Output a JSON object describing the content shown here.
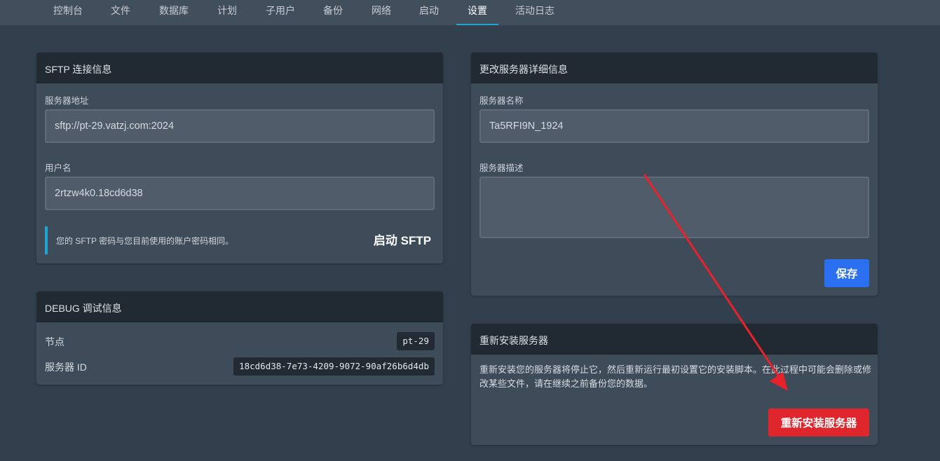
{
  "nav": {
    "items": [
      "控制台",
      "文件",
      "数据库",
      "计划",
      "子用户",
      "备份",
      "网络",
      "启动",
      "设置",
      "活动日志"
    ],
    "active": "设置"
  },
  "sftp": {
    "title": "SFTP 连接信息",
    "address_label": "服务器地址",
    "address_value": "sftp://pt-29.vatzj.com:2024",
    "username_label": "用户名",
    "username_value": "2rtzw4k0.18cd6d38",
    "notice": "您的 SFTP 密码与您目前使用的账户密码相同。",
    "launch_label": "启动 SFTP"
  },
  "debug": {
    "title": "DEBUG 调试信息",
    "node_label": "节点",
    "node_value": "pt-29",
    "server_id_label": "服务器 ID",
    "server_id_value": "18cd6d38-7e73-4209-9072-90af26b6d4db"
  },
  "details": {
    "title": "更改服务器详细信息",
    "name_label": "服务器名称",
    "name_value": "Ta5RFI9N_1924",
    "description_label": "服务器描述",
    "description_value": "",
    "save_label": "保存"
  },
  "reinstall": {
    "title": "重新安装服务器",
    "description": "重新安装您的服务器将停止它，然后重新运行最初设置它的安装脚本。在此过程中可能会删除或修改某些文件，请在继续之前备份您的数据。",
    "button_label": "重新安装服务器"
  },
  "colors": {
    "accent": "#1ea7d3",
    "save_button": "#2a6ff0",
    "danger_button": "#e0262d",
    "annotation_arrow": "#e8222a"
  }
}
